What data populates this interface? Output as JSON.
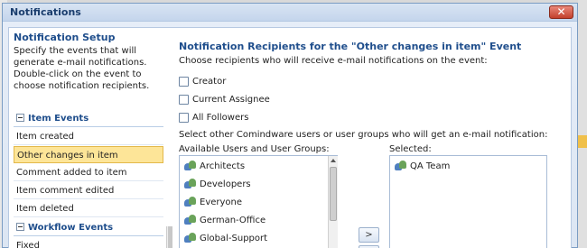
{
  "window": {
    "title": "Notifications",
    "close_glyph": "✕"
  },
  "left": {
    "title": "Notification Setup",
    "description": "Specify the events that will generate e-mail notifications. Double-click on the event to choose notification recipients.",
    "item_events_header": "Item Events",
    "item_events": [
      "Item created",
      "Other changes in item",
      "Comment added to item",
      "Item comment edited",
      "Item deleted"
    ],
    "selected_event": "Other changes in item",
    "workflow_events_header": "Workflow Events",
    "workflow_events": [
      "Fixed"
    ]
  },
  "right": {
    "title": "Notification Recipients for the \"Other changes in item\" Event",
    "subtitle": "Choose recipients who will receive e-mail notifications on the event:",
    "checkboxes": [
      {
        "label": "Creator",
        "checked": false
      },
      {
        "label": "Current Assignee",
        "checked": false
      },
      {
        "label": "All Followers",
        "checked": false
      }
    ],
    "select_other": "Select other Comindware users or user groups who will get an e-mail notification:",
    "available_label": "Available Users and User Groups:",
    "available": [
      "Architects",
      "Developers",
      "Everyone",
      "German-Office",
      "Global-Support"
    ],
    "selected_label": "Selected:",
    "selected": [
      "QA Team"
    ],
    "move_button": ">"
  }
}
